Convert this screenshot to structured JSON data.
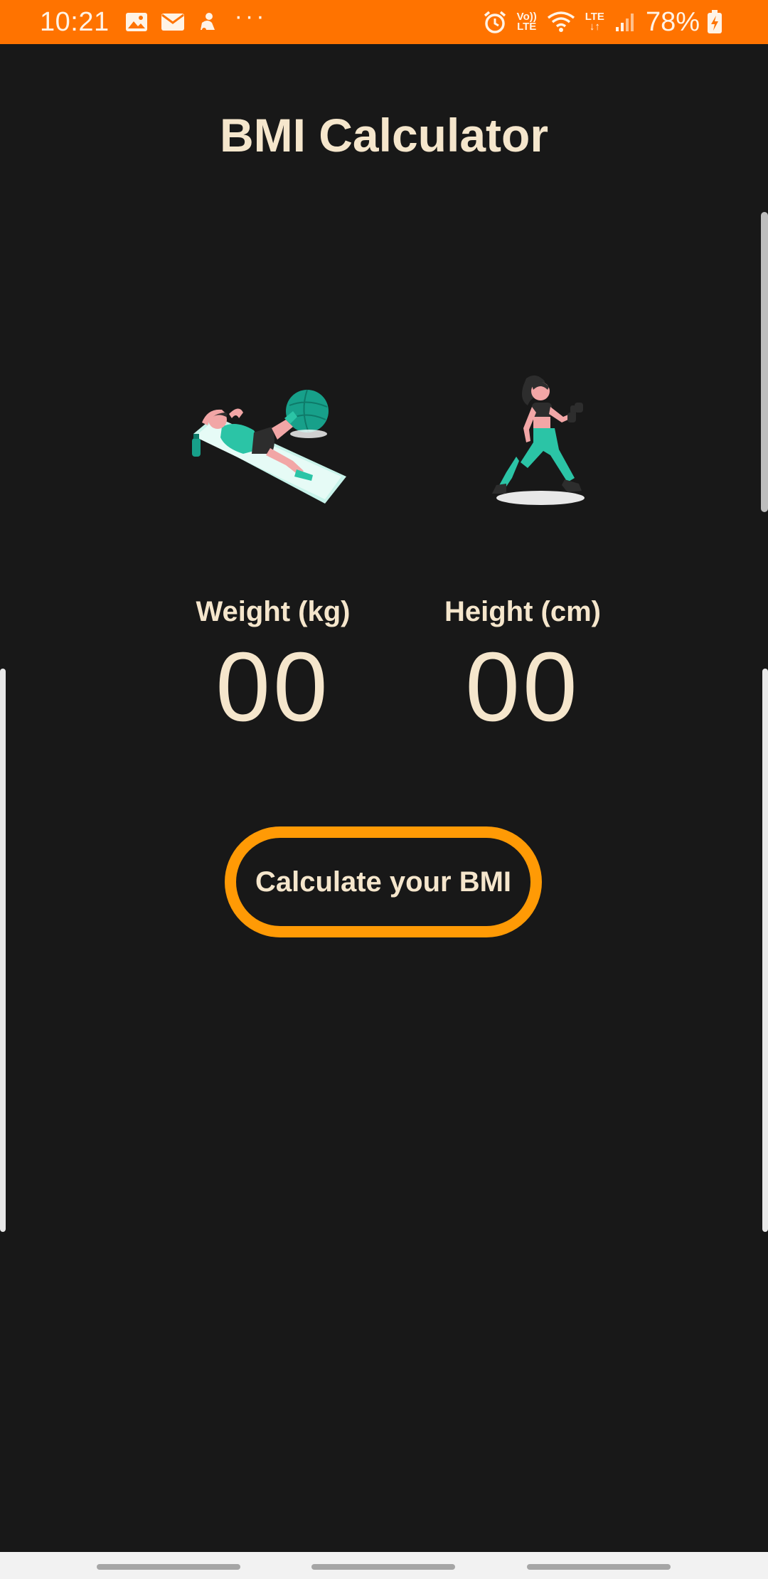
{
  "status_bar": {
    "time": "10:21",
    "network_top": "Vo))",
    "network_bottom": "LTE",
    "lte_label": "LTE",
    "battery_percent": "78%",
    "background_color": "#ff7300",
    "icons": [
      "image-icon",
      "mail-icon",
      "notification-icon",
      "more-dots-icon",
      "alarm-icon",
      "volte-icon",
      "wifi-icon",
      "lte-data-icon",
      "signal-icon",
      "battery-charging-icon"
    ]
  },
  "app": {
    "title": "BMI Calculator",
    "accent_color": "#ff9a05",
    "text_color": "#f5e6cc",
    "background_color": "#181818"
  },
  "illustrations": {
    "left": "person-doing-crunches-illustration",
    "right": "person-lifting-dumbbell-illustration"
  },
  "weight": {
    "label": "Weight (kg)",
    "value": "00"
  },
  "height": {
    "label": "Height (cm)",
    "value": "00"
  },
  "button": {
    "label": "Calculate your BMI"
  }
}
